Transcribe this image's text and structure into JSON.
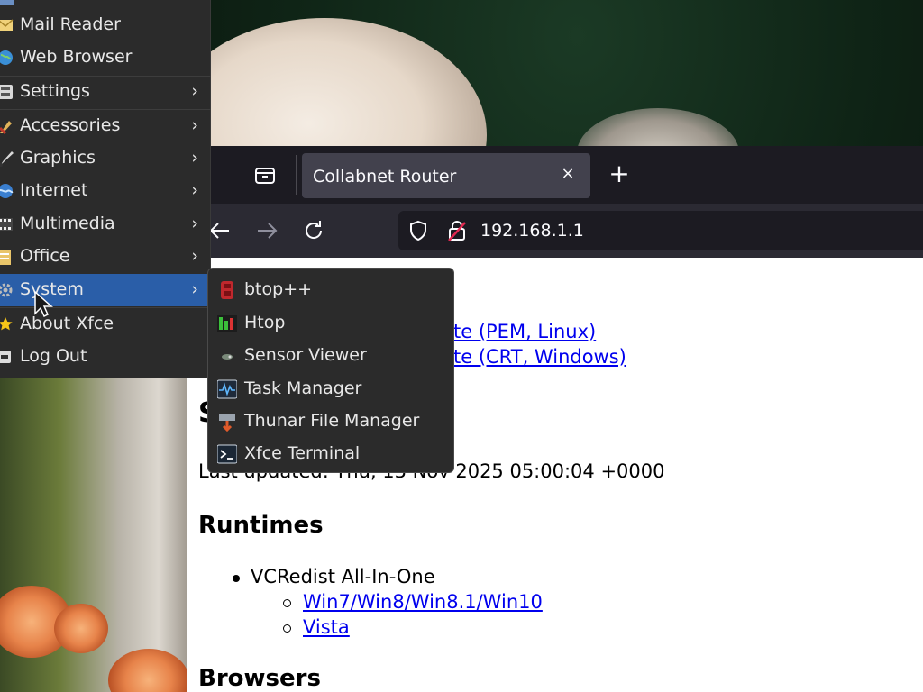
{
  "desktop": {
    "menu": {
      "items": [
        {
          "label": "Mail Reader",
          "icon": "mail-icon"
        },
        {
          "label": "Web Browser",
          "icon": "globe-icon"
        },
        {
          "label": "Settings",
          "icon": "settings-icon",
          "submenu": true
        },
        {
          "label": "Accessories",
          "icon": "accessories-icon",
          "submenu": true
        },
        {
          "label": "Graphics",
          "icon": "graphics-icon",
          "submenu": true
        },
        {
          "label": "Internet",
          "icon": "internet-icon",
          "submenu": true
        },
        {
          "label": "Multimedia",
          "icon": "multimedia-icon",
          "submenu": true
        },
        {
          "label": "Office",
          "icon": "office-icon",
          "submenu": true
        },
        {
          "label": "System",
          "icon": "system-gear-icon",
          "submenu": true,
          "selected": true
        },
        {
          "label": "About Xfce",
          "icon": "star-icon"
        },
        {
          "label": "Log Out",
          "icon": "logout-icon"
        }
      ],
      "arrow": "›"
    },
    "system_submenu": {
      "items": [
        {
          "label": "btop++",
          "icon": "btop-icon"
        },
        {
          "label": "Htop",
          "icon": "htop-icon"
        },
        {
          "label": "Sensor Viewer",
          "icon": "sensor-icon"
        },
        {
          "label": "Task Manager",
          "icon": "task-manager-icon"
        },
        {
          "label": "Thunar File Manager",
          "icon": "file-manager-icon"
        },
        {
          "label": "Xfce Terminal",
          "icon": "terminal-icon"
        }
      ]
    }
  },
  "browser": {
    "tab": {
      "title": "Collabnet Router",
      "close": "×"
    },
    "new_tab": "+",
    "url": "192.168.1.1",
    "accent": "#2a5ea8"
  },
  "page": {
    "link_pem": "te (PEM, Linux)",
    "link_crt": "te (CRT, Windows)",
    "heading_partial": "S",
    "last_updated": "Last updated: Thu, 13 Nov 2025 05:00:04 +0000",
    "runtimes_heading": "Runtimes",
    "vcredist": "VCRedist All-In-One",
    "win_link": "Win7/Win8/Win8.1/Win10",
    "vista_link": "Vista",
    "browsers_heading": "Browsers"
  }
}
